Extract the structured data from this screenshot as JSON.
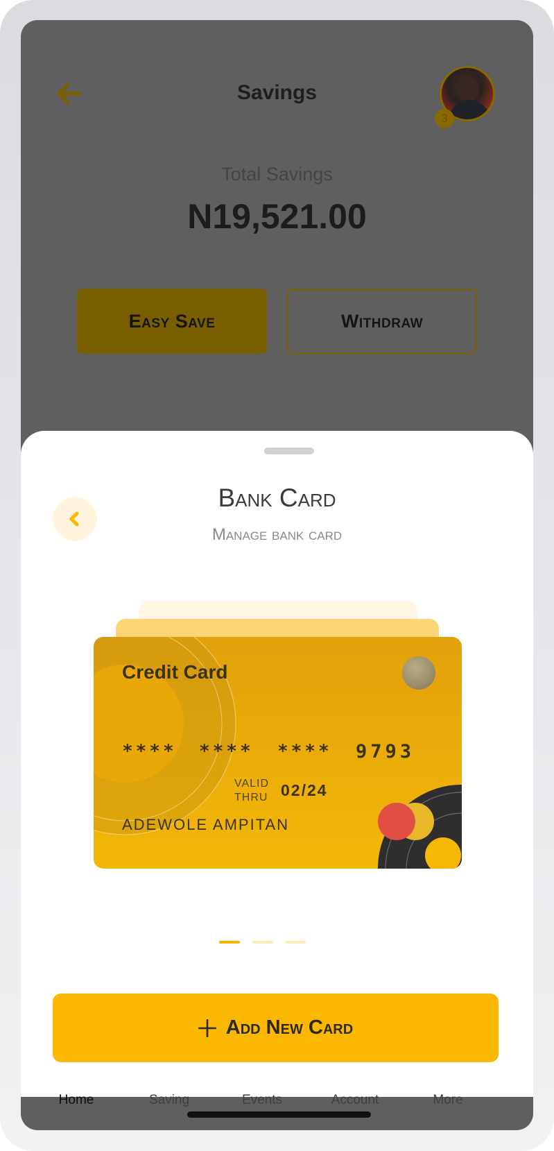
{
  "header": {
    "title": "Savings",
    "notification_count": "3"
  },
  "summary": {
    "label": "Total Savings",
    "amount": "N19,521.00"
  },
  "actions": {
    "easy_save_label": "Easy Save",
    "withdraw_label": "Withdraw"
  },
  "sheet": {
    "title": "Bank Card",
    "subtitle": "Manage bank card",
    "card": {
      "type": "Credit Card",
      "number_groups": [
        "****",
        "****",
        "****",
        "9793"
      ],
      "valid_label": "VALID THRU",
      "expiry": "02/24",
      "holder": "ADEWOLE AMPITAN"
    },
    "pager": {
      "count": 3,
      "active_index": 0
    },
    "add_button_label": "Add New Card"
  },
  "tabs": [
    "Home",
    "Saving",
    "Events",
    "Account",
    "More"
  ],
  "colors": {
    "accent": "#fcb700",
    "card_gold": "#f3b708",
    "overlay_gray": "#5f5f5f",
    "dark_gold": "#7a5f00"
  },
  "icons": {
    "back": "arrow-left-icon",
    "sheet_back": "chevron-left-icon",
    "add": "plus-icon"
  }
}
